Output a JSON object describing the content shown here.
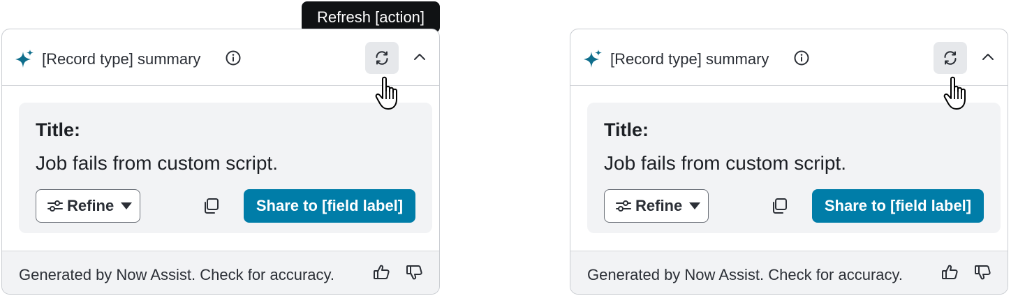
{
  "tooltip": {
    "text": "Refresh [action]"
  },
  "cards": [
    {
      "header_title": "[Record type] summary",
      "body_label": "Title:",
      "body_text": "Job fails from custom script.",
      "refine_label": "Refine",
      "share_label": "Share to [field label]",
      "footer_text": "Generated by Now Assist. Check for accuracy."
    },
    {
      "header_title": "[Record type] summary",
      "body_label": "Title:",
      "body_text": "Job fails from custom script.",
      "refine_label": "Refine",
      "share_label": "Share to [field label]",
      "footer_text": "Generated by Now Assist. Check for accuracy."
    }
  ],
  "icons": {
    "sparkle": "sparkle-icon",
    "info": "info-icon",
    "refresh": "refresh-icon",
    "collapse": "chevron-up-icon",
    "refine": "sliders-icon",
    "dropdown": "caret-down-icon",
    "copy": "copy-icon",
    "thumbs_up": "thumbs-up-icon",
    "thumbs_down": "thumbs-down-icon",
    "pointer": "hand-pointer-icon"
  },
  "colors": {
    "accent": "#007da8",
    "sparkle": "#0f6e8c",
    "tooltip_bg": "#101214",
    "panel_bg": "#f2f3f5"
  }
}
